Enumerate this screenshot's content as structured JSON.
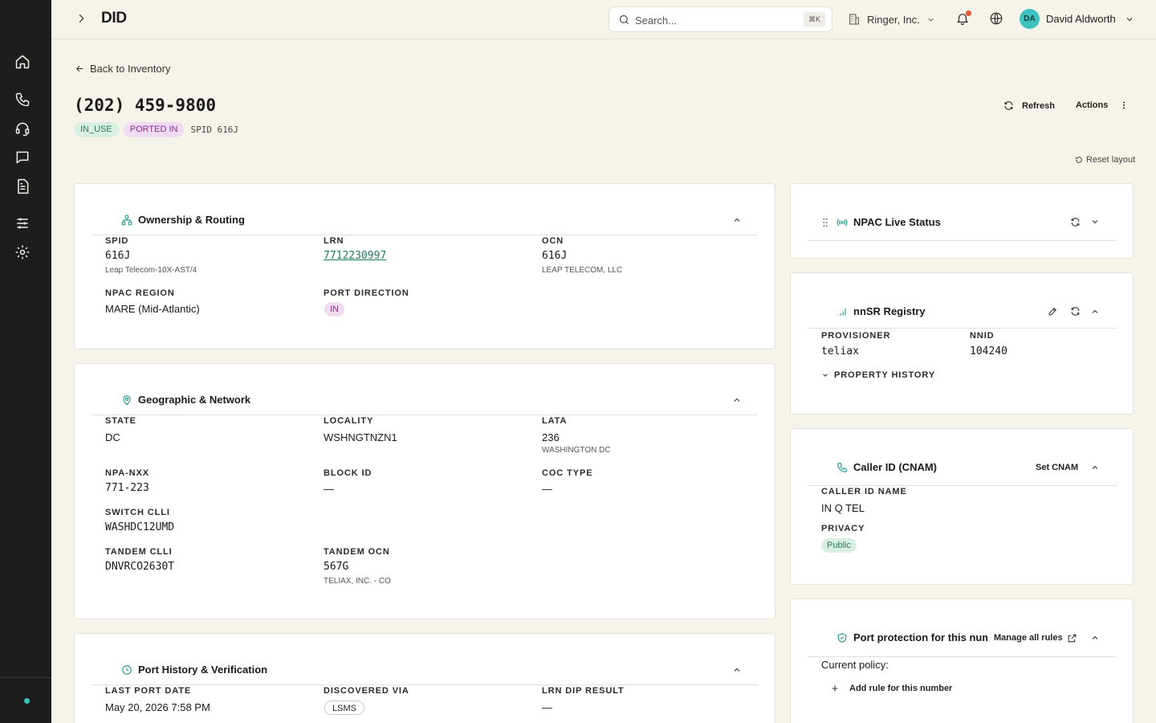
{
  "topbar": {
    "title": "DID",
    "search_placeholder": "Search...",
    "search_shortcut": "⌘K",
    "org_name": "Ringer, Inc.",
    "user_initials": "DA",
    "user_name": "David Aldworth"
  },
  "header": {
    "back_label": "Back to Inventory",
    "phone_number": "(202) 459-9800",
    "badges": [
      "IN_USE",
      "PORTED IN"
    ],
    "spid_tag": "SPID 616J",
    "refresh_label": "Refresh",
    "actions_label": "Actions",
    "reset_layout_label": "Reset layout"
  },
  "ownership": {
    "title": "Ownership & Routing",
    "spid_label": "SPID",
    "spid_value": "616J",
    "spid_sub": "Leap Telecom-10X-AST/4",
    "lrn_label": "LRN",
    "lrn_value": "7712230997",
    "ocn_label": "OCN",
    "ocn_value": "616J",
    "ocn_sub": "LEAP TELECOM, LLC",
    "region_label": "NPAC REGION",
    "region_value": "MARE (Mid-Atlantic)",
    "port_dir_label": "PORT DIRECTION",
    "port_dir_value": "IN"
  },
  "geo": {
    "title": "Geographic & Network",
    "state_label": "STATE",
    "state_value": "DC",
    "locality_label": "LOCALITY",
    "locality_value": "WSHNGTNZN1",
    "lata_label": "LATA",
    "lata_value": "236",
    "lata_sub": "WASHINGTON DC",
    "npa_label": "NPA-NXX",
    "npa_value": "771-223",
    "block_label": "BLOCK ID",
    "block_value": "—",
    "coc_label": "COC TYPE",
    "coc_value": "—",
    "switch_label": "SWITCH CLLI",
    "switch_value": "WASHDC12UMD",
    "tandem_clli_label": "TANDEM CLLI",
    "tandem_clli_value": "DNVRCO2630T",
    "tandem_ocn_label": "TANDEM OCN",
    "tandem_ocn_value": "567G",
    "tandem_ocn_sub": "TELIAX, INC. - CO"
  },
  "port_history": {
    "title": "Port History & Verification",
    "last_port_label": "LAST PORT DATE",
    "last_port_value": "May 20, 2026 7:58 PM",
    "discovered_label": "DISCOVERED VIA",
    "discovered_value": "LSMS",
    "dip_label": "LRN DIP RESULT",
    "dip_value": "—"
  },
  "npac": {
    "title": "NPAC Live Status"
  },
  "nnsr": {
    "title": "nnSR Registry",
    "provisioner_label": "PROVISIONER",
    "provisioner_value": "teliax",
    "nnid_label": "NNID",
    "nnid_value": "104240",
    "history_label": "PROPERTY HISTORY"
  },
  "cnam": {
    "title": "Caller ID (CNAM)",
    "set_label": "Set CNAM",
    "name_label": "CALLER ID NAME",
    "name_value": "IN Q TEL",
    "privacy_label": "PRIVACY",
    "privacy_value": "Public"
  },
  "protection": {
    "title": "Port protection for this number",
    "manage_label": "Manage all rules",
    "policy_label": "Current policy:",
    "add_rule_label": "Add rule for this number"
  },
  "colors": {
    "accent": "#2a9d8f",
    "sidebar": "#1d1d1d",
    "background": "#f6f3ea"
  }
}
